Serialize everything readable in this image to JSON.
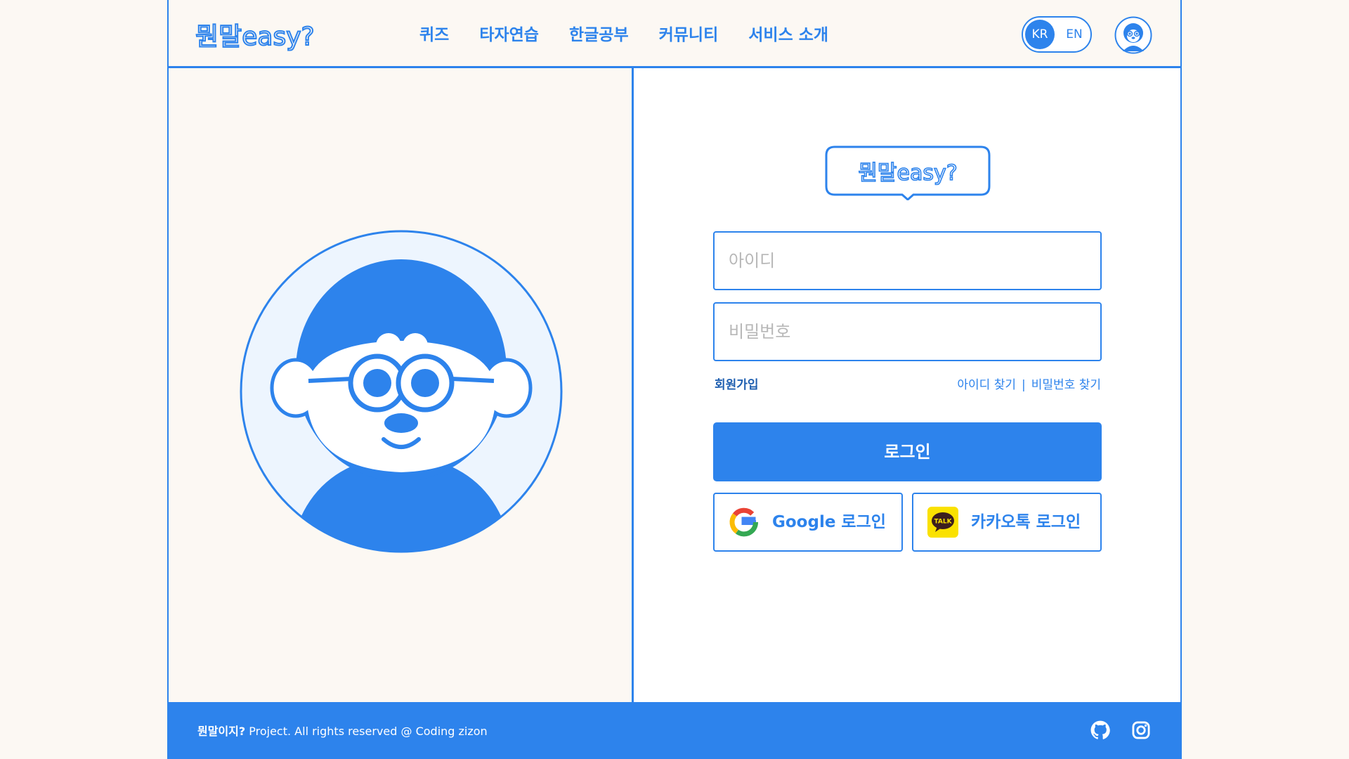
{
  "brand": {
    "logo_text": "뭔말easy?"
  },
  "nav": {
    "items": [
      "퀴즈",
      "타자연습",
      "한글공부",
      "커뮤니티",
      "서비스 소개"
    ]
  },
  "lang": {
    "kr": "KR",
    "en": "EN",
    "selected": "KR"
  },
  "login": {
    "id_placeholder": "아이디",
    "pw_placeholder": "비밀번호",
    "signup": "회원가입",
    "find_id": "아이디 찾기",
    "separator": "|",
    "find_pw": "비밀번호 찾기",
    "login_button": "로그인",
    "google_button": "Google 로그인",
    "kakao_button": "카카오톡 로그인",
    "kakao_icon_text": "TALK"
  },
  "footer": {
    "project": "뭔말이지?",
    "rights": " Project. All rights reserved @ Coding zizon"
  },
  "colors": {
    "accent": "#2d83ec",
    "background": "#fcf8f3",
    "avatar_bg": "#edf5fe",
    "kakao_yellow": "#fae100"
  },
  "icons": {
    "header_avatar": "character-avatar-icon",
    "google": "google-g-icon",
    "kakao": "kakaotalk-icon",
    "github": "github-icon",
    "instagram": "instagram-icon"
  }
}
